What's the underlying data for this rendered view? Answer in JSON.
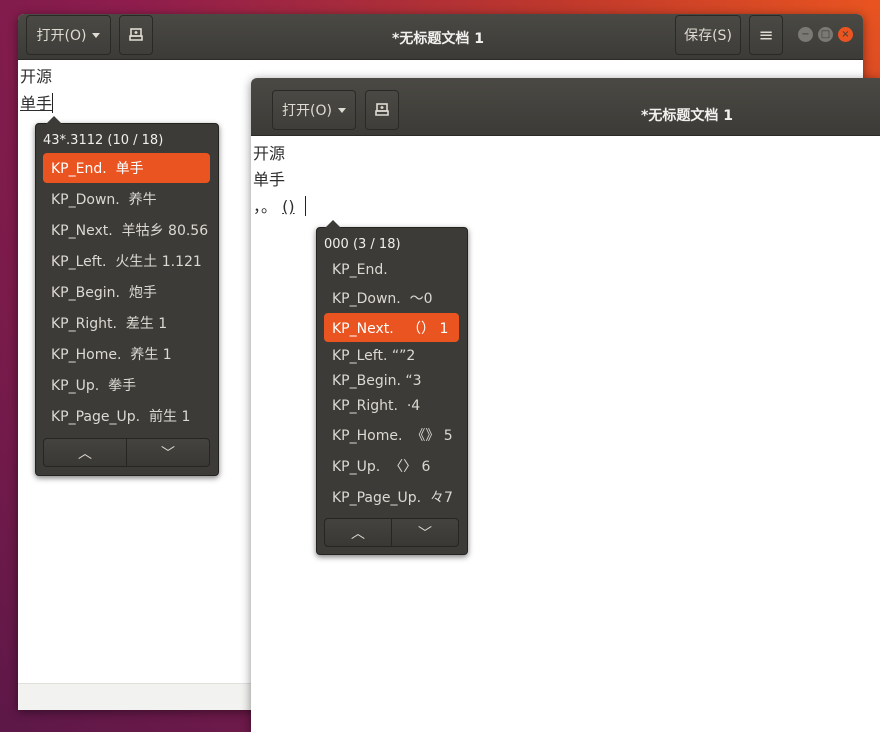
{
  "window_back": {
    "open_label": "打开(O)",
    "title": "*无标题文档 1",
    "save_label": "保存(S)",
    "lines": [
      "开源",
      "单手"
    ],
    "popup": {
      "header": "43*.3112 (10 / 18)",
      "candidates": [
        "KP_End.  单手",
        "KP_Down.  养牛",
        "KP_Next.  羊牯乡 80.56",
        "KP_Left.  火生土 1.121",
        "KP_Begin.  炮手",
        "KP_Right.  差生 1",
        "KP_Home.  养生 1",
        "KP_Up.  拳手",
        "KP_Page_Up.  前生 1"
      ],
      "selected_index": 0
    }
  },
  "window_front": {
    "open_label": "打开(O)",
    "title": "*无标题文档 1",
    "lines": [
      "开源",
      "单手"
    ],
    "line3_prefix": "，。",
    "line3_preedit": "()",
    "popup": {
      "header": "000 (3 / 18)",
      "candidates": [
        "KP_End.",
        "KP_Down.  ～0",
        "KP_Next.   （） 1",
        "KP_Left. “”2",
        "KP_Begin. “3",
        "KP_Right.  ·4",
        "KP_Home.  《》 5",
        "KP_Up.  〈〉 6",
        "KP_Page_Up.  々7"
      ],
      "selected_index": 2
    }
  },
  "icons": {
    "menu": "≡",
    "minimize": "−",
    "maximize": "□",
    "close": "×",
    "chevron_up": "︿",
    "chevron_down": "﹀"
  },
  "colors": {
    "accent": "#e95420",
    "headerbar": "#3c3b37",
    "popup_bg": "#3c3b37"
  }
}
